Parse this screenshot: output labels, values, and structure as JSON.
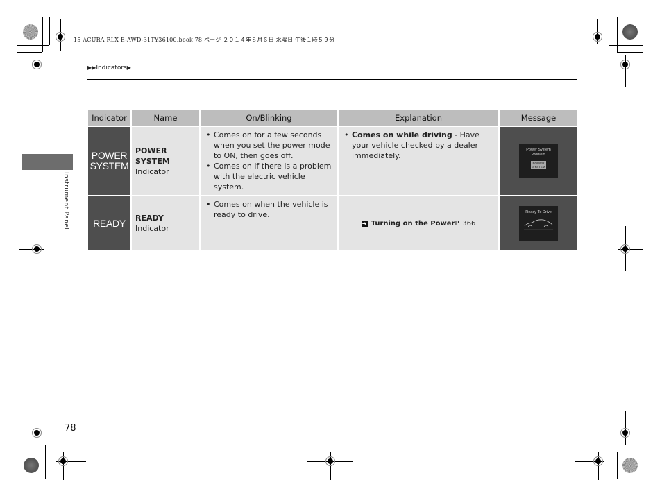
{
  "print_meta": "15 ACURA RLX E-AWD-31TY36100.book  78 ページ  ２０１４年８月６日  水曜日  午後１時５９分",
  "breadcrumb": {
    "prefix": "▶▶",
    "label": "Indicators",
    "suffix": "▶"
  },
  "side_tab": {
    "label": "Instrument Panel"
  },
  "table": {
    "headers": [
      "Indicator",
      "Name",
      "On/Blinking",
      "Explanation",
      "Message"
    ],
    "rows": [
      {
        "indicator_lines": [
          "POWER",
          "SYSTEM"
        ],
        "name_bold": "POWER SYSTEM",
        "name_rest": "Indicator",
        "on_blinking": [
          "Comes on for a few seconds when you set the power mode to ON, then goes off.",
          "Comes on if there is a problem with the electric vehicle system."
        ],
        "explanation_bold": "Comes on while driving",
        "explanation_rest": " - Have your vehicle checked by a dealer immediately.",
        "message_title": "Power System Problem",
        "message_badge": "POWER SYSTEM"
      },
      {
        "indicator_lines": [
          "READY"
        ],
        "name_bold": "READY",
        "name_rest": " Indicator",
        "on_blinking": [
          "Comes on when the vehicle is ready to drive."
        ],
        "xref_icon": "arrow-right-box-icon",
        "xref_bold": "Turning on the Power",
        "xref_page": " P. 366",
        "message_title": "Ready To Drive"
      }
    ]
  },
  "page_number": "78"
}
